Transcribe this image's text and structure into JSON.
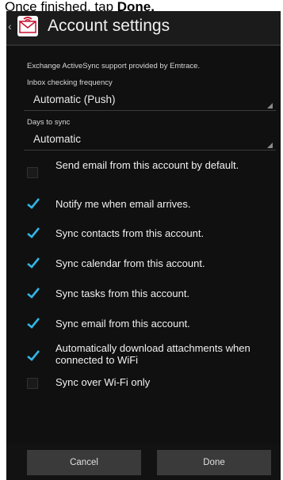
{
  "caption": {
    "text_normal": "Once finished, tap ",
    "text_bold": "Done."
  },
  "action_bar": {
    "title": "Account settings",
    "app_icon": "email-app-icon",
    "up_icon": "up-caret-icon"
  },
  "settings": {
    "provider_note": "Exchange ActiveSync support provided by Emtrace.",
    "inbox_frequency": {
      "label": "Inbox checking frequency",
      "value": "Automatic (Push)"
    },
    "days_to_sync": {
      "label": "Days to sync",
      "value": "Automatic"
    },
    "checkboxes": [
      {
        "label": "Send email from this account by default.",
        "checked": false
      },
      {
        "label": "Notify me when email arrives.",
        "checked": true
      },
      {
        "label": "Sync contacts from this account.",
        "checked": true
      },
      {
        "label": "Sync calendar from this account.",
        "checked": true
      },
      {
        "label": "Sync tasks from this account.",
        "checked": true
      },
      {
        "label": "Sync email from this account.",
        "checked": true
      },
      {
        "label": "Automatically download attachments when connected to WiFi",
        "checked": true
      },
      {
        "label": "Sync over Wi-Fi only",
        "checked": false
      }
    ]
  },
  "buttons": {
    "cancel": "Cancel",
    "done": "Done"
  },
  "colors": {
    "accent": "#33b5e5",
    "background": "#101010"
  }
}
